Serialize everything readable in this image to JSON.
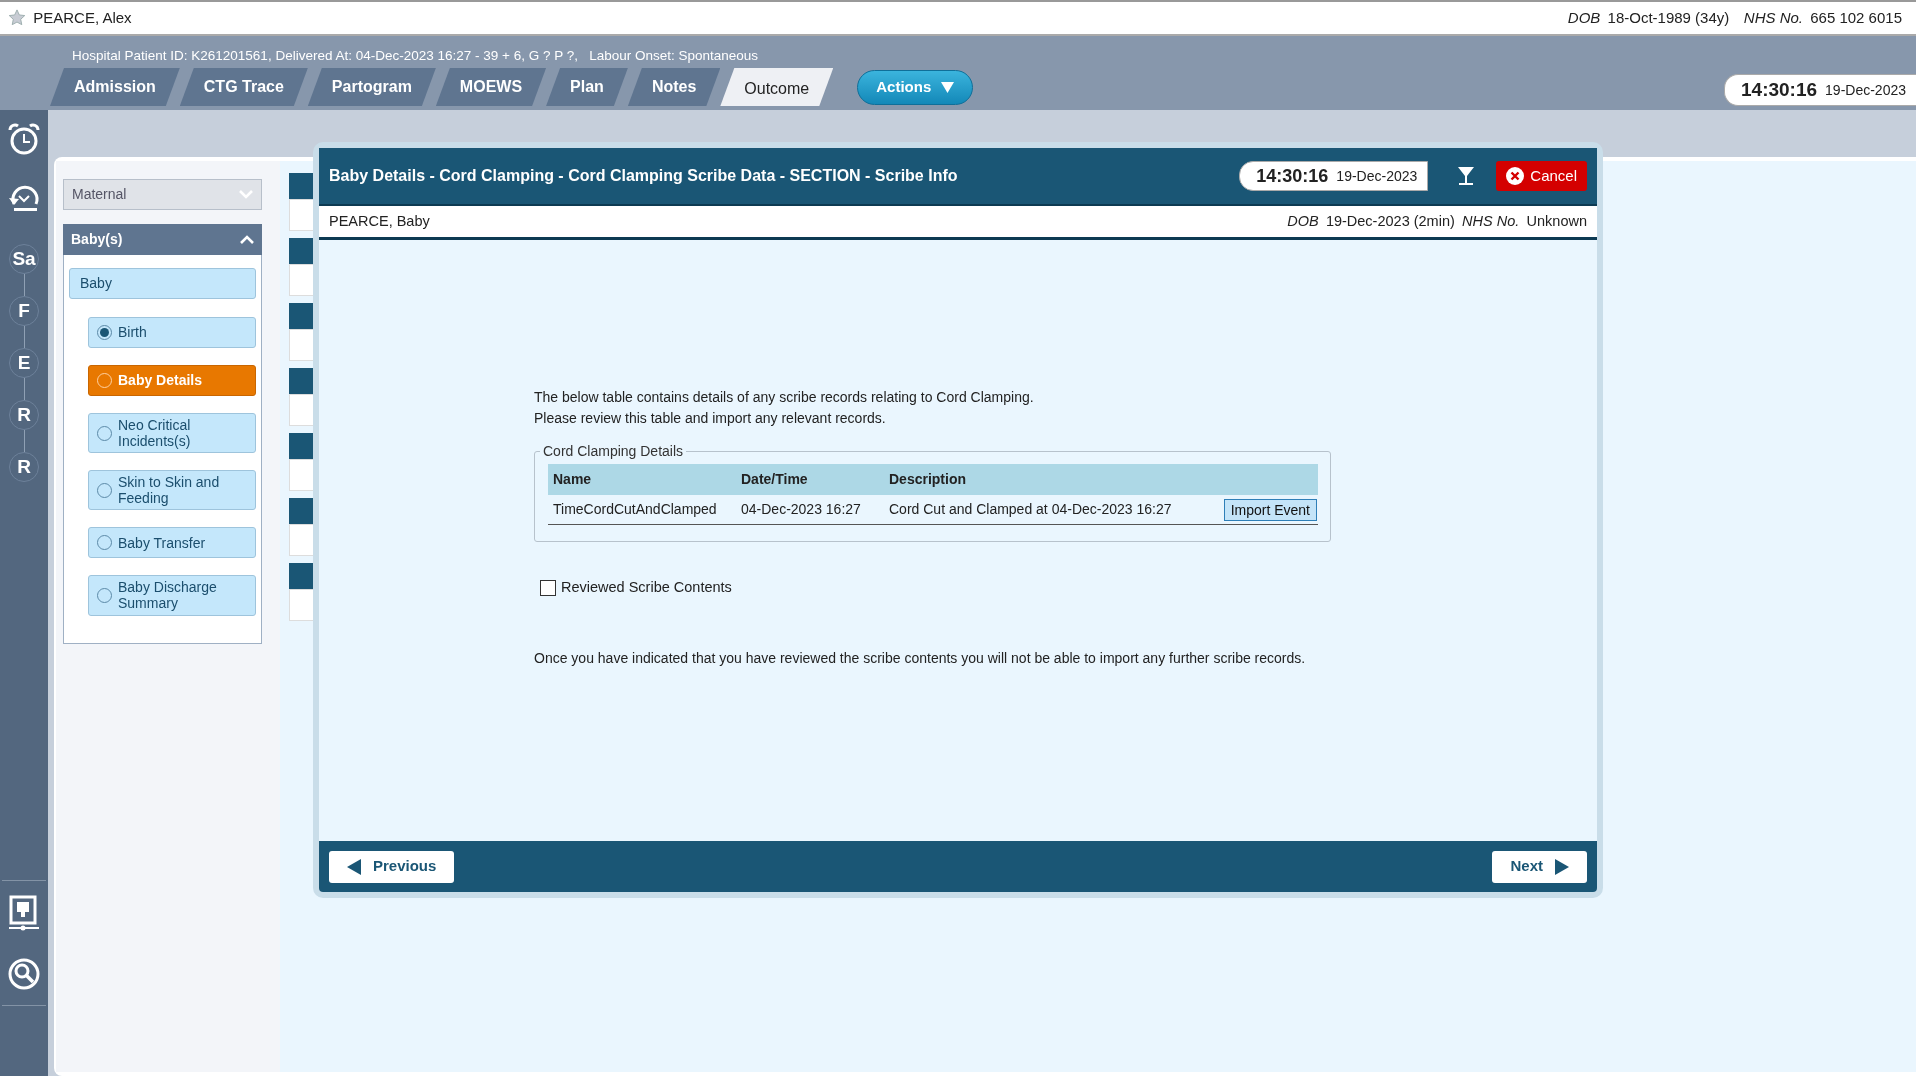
{
  "patient": {
    "name": "PEARCE, Alex",
    "dob_label": "DOB",
    "dob": "18-Oct-1989 (34y)",
    "nhs_label": "NHS No.",
    "nhs": "665 102 6015"
  },
  "info_line": "Hospital Patient ID: K261201561, Delivered At: 04-Dec-2023 16:27 - 39 + 6, G ? P ?,   Labour Onset: Spontaneous",
  "tabs": [
    {
      "label": "Admission",
      "selected": false
    },
    {
      "label": "CTG Trace",
      "selected": false
    },
    {
      "label": "Partogram",
      "selected": false
    },
    {
      "label": "MOEWS",
      "selected": false
    },
    {
      "label": "Plan",
      "selected": false
    },
    {
      "label": "Notes",
      "selected": false
    },
    {
      "label": "Outcome",
      "selected": true
    }
  ],
  "actions_button": "Actions",
  "clock": {
    "time": "14:30:16",
    "date": "19-Dec-2023"
  },
  "rail_letters": [
    "Sa",
    "F",
    "E",
    "R",
    "R"
  ],
  "sidebar": {
    "groups": [
      {
        "label": "Maternal",
        "expanded": false
      },
      {
        "label": "Baby(s)",
        "expanded": true
      }
    ],
    "items": [
      {
        "label": "Baby",
        "children": [
          {
            "label": "Birth",
            "checked": true,
            "selected": false
          },
          {
            "label": "Baby Details",
            "checked": false,
            "selected": true
          },
          {
            "label": "Neo Critical Incidents(s)",
            "checked": false,
            "selected": false
          },
          {
            "label": "Skin to Skin and Feeding",
            "checked": false,
            "selected": false
          },
          {
            "label": "Baby Transfer",
            "checked": false,
            "selected": false
          },
          {
            "label": "Baby Discharge Summary",
            "checked": false,
            "selected": false
          }
        ]
      }
    ]
  },
  "modal": {
    "title": "Baby Details - Cord Clamping - Cord Clamping Scribe Data - SECTION - Scribe Info",
    "clock": {
      "time": "14:30:16",
      "date": "19-Dec-2023"
    },
    "cancel": "Cancel",
    "baby": {
      "name": "PEARCE, Baby",
      "dob_label": "DOB",
      "dob": "19-Dec-2023 (2min)",
      "nhs_label": "NHS No.",
      "nhs": "Unknown"
    },
    "intro": [
      "The below table contains details of any scribe records relating to Cord Clamping.",
      "Please review this table and import any relevant records."
    ],
    "fieldset": {
      "legend": "Cord Clamping Details",
      "columns": [
        "Name",
        "Date/Time",
        "Description"
      ],
      "rows": [
        {
          "cells": [
            "TimeCordCutAndClamped",
            "04-Dec-2023 16:27",
            "Cord Cut and Clamped at 04-Dec-2023 16:27"
          ],
          "action": "Import Event"
        }
      ]
    },
    "reviewed": {
      "label": "Reviewed Scribe Contents",
      "checked": false
    },
    "note": "Once you have indicated that you have reviewed the scribe contents you will not be able to import any further scribe records.",
    "previous": "Previous",
    "next": "Next"
  }
}
